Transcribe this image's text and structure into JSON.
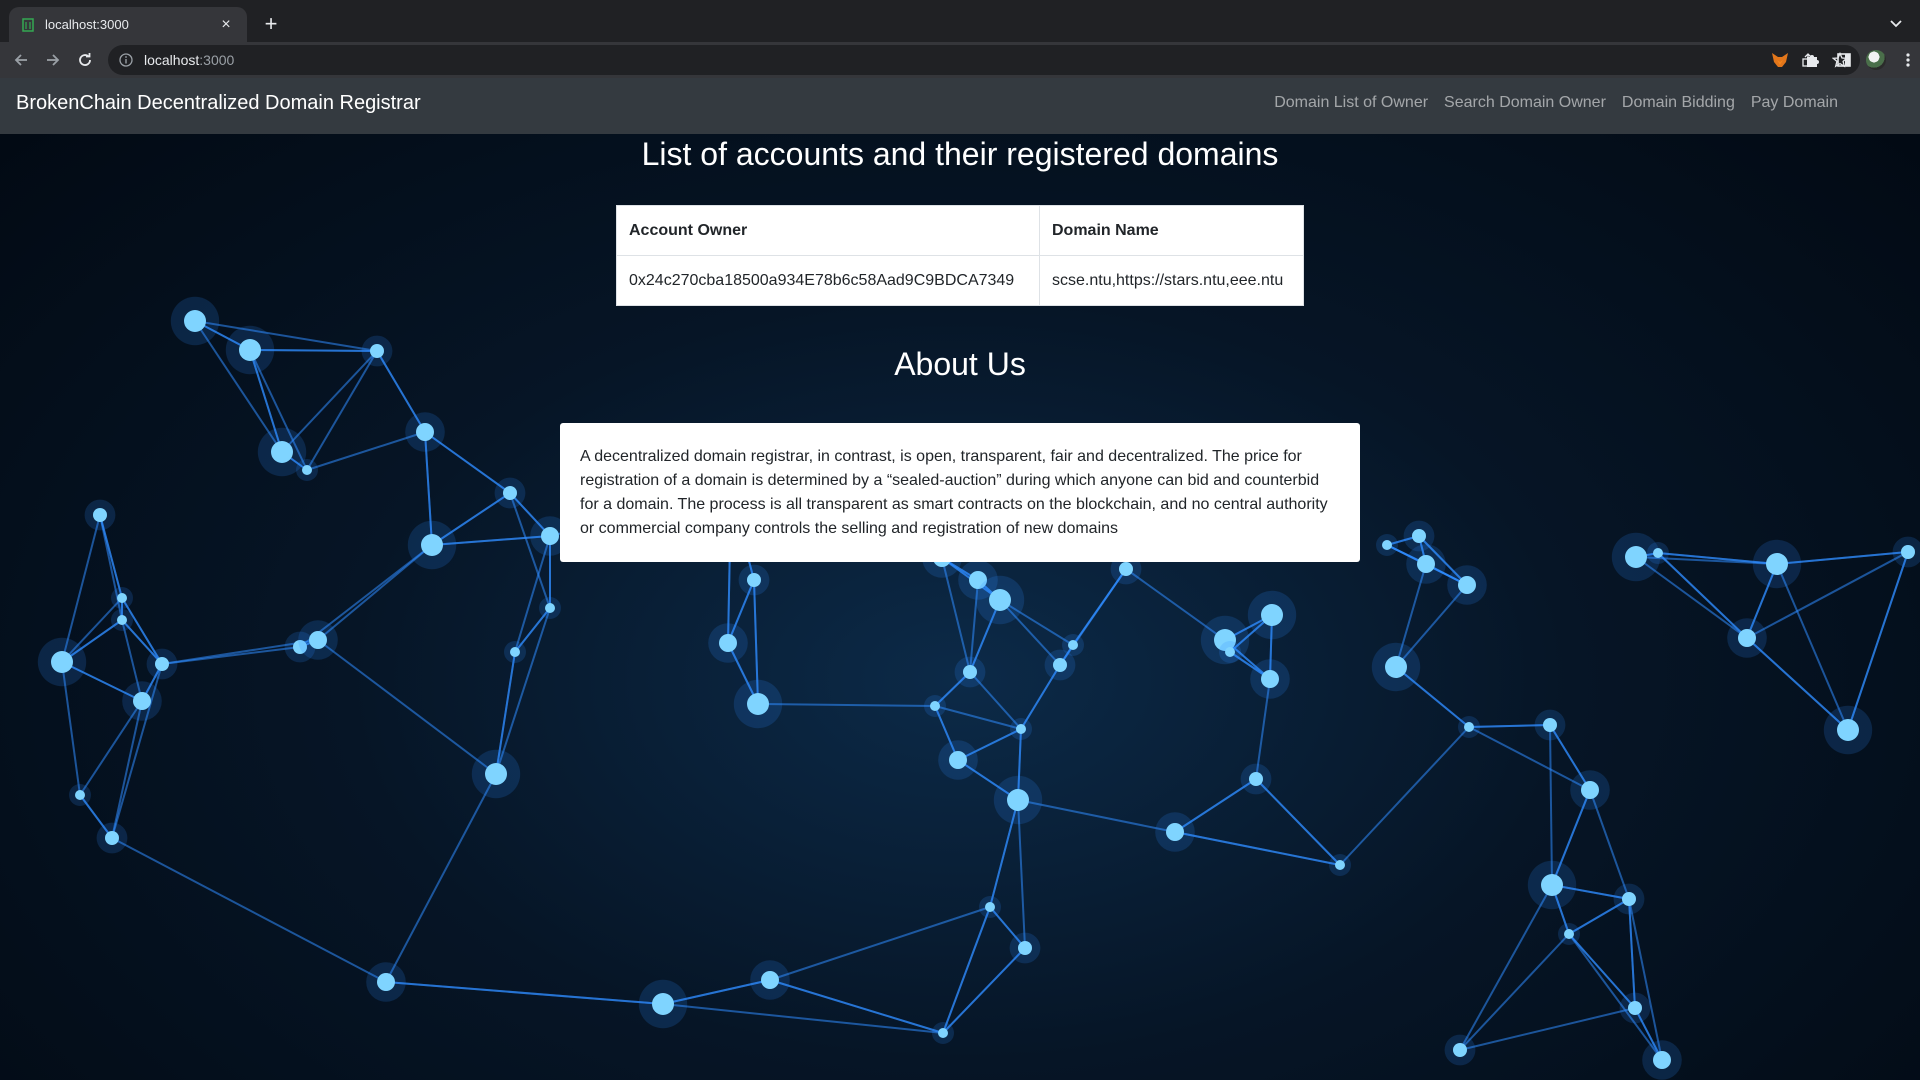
{
  "browser": {
    "tab_title": "localhost:3000",
    "url_host": "localhost",
    "url_port": ":3000"
  },
  "site": {
    "brand": "BrokenChain Decentralized Domain Registrar",
    "nav": [
      {
        "label": "Domain List of Owner"
      },
      {
        "label": "Search Domain Owner"
      },
      {
        "label": "Domain Bidding"
      },
      {
        "label": "Pay Domain"
      }
    ]
  },
  "domains_section": {
    "title": "List of accounts and their registered domains",
    "columns": [
      "Account Owner",
      "Domain Name"
    ],
    "rows": [
      [
        "0x24c270cba18500a934E78b6c58Aad9C9BDCA7349",
        "scse.ntu,https://stars.ntu,eee.ntu"
      ]
    ]
  },
  "about": {
    "title": "About Us",
    "text": "A decentralized domain registrar, in contrast, is open, transparent, fair and decentralized. The price for registration of a domain is determined by a “sealed-auction” during which anyone can bid and counterbid for a domain. The process is all transparent as smart contracts on the blockchain, and no central authority or commercial company controls the selling and registration of new domains"
  },
  "colors": {
    "navbar": "#343a40",
    "background": "#061526",
    "network_line": "#2f8cff",
    "network_node": "#7fd4ff"
  }
}
